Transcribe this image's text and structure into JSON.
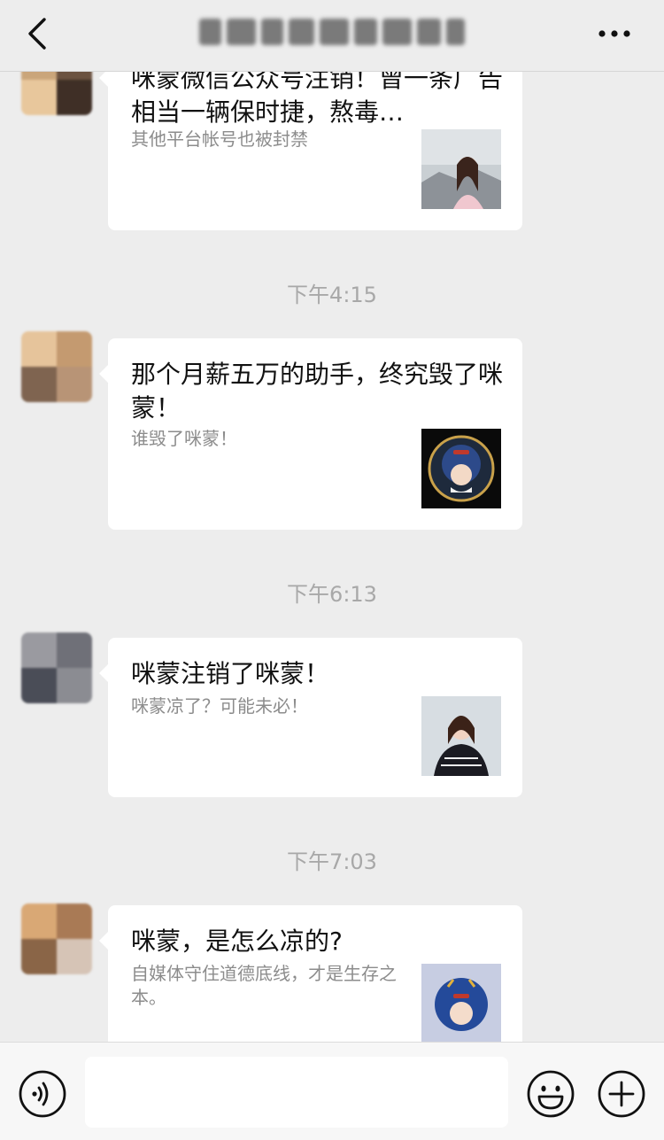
{
  "header": {
    "title": "",
    "back_icon": "chevron-left-icon",
    "more_icon": "more-horizontal-icon"
  },
  "messages": [
    {
      "headline": "咪蒙微信公众号注销！曾一条广告相当一辆保时捷，熬毒…",
      "sub": "其他平台帐号也被封禁"
    },
    {
      "time": "下午4:15",
      "headline": "那个月薪五万的助手，终究毁了咪蒙！",
      "sub": "谁毁了咪蒙！"
    },
    {
      "time": "下午6:13",
      "headline": "咪蒙注销了咪蒙！",
      "sub": "咪蒙凉了？可能未必！"
    },
    {
      "time": "下午7:03",
      "headline": "咪蒙，是怎么凉的?",
      "sub": "自媒体守住道德底线，才是生存之本。"
    }
  ],
  "composer": {
    "voice_icon": "voice-icon",
    "emoji_icon": "emoji-icon",
    "plus_icon": "plus-icon",
    "input_value": ""
  }
}
